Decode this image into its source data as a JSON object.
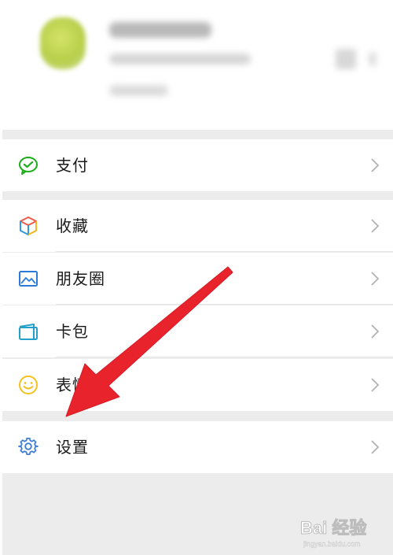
{
  "menu": {
    "items": [
      {
        "id": "pay",
        "label": "支付",
        "icon": "wechat-pay-icon"
      },
      {
        "id": "favorites",
        "label": "收藏",
        "icon": "cube-icon"
      },
      {
        "id": "moments",
        "label": "朋友圈",
        "icon": "image-icon"
      },
      {
        "id": "cards",
        "label": "卡包",
        "icon": "card-wallet-icon"
      },
      {
        "id": "stickers",
        "label": "表情",
        "icon": "smiley-icon"
      },
      {
        "id": "settings",
        "label": "设置",
        "icon": "gear-icon"
      }
    ]
  },
  "colors": {
    "pay_green": "#1aad19",
    "moments_blue": "#2b7bd8",
    "cards_teal": "#25a0c8",
    "sticker_yellow": "#f4c21f",
    "settings_blue": "#3d7fd6",
    "arrow_red": "#e8232c",
    "separator_gray": "#ececec"
  },
  "annotation": {
    "type": "arrow",
    "points_to": "settings"
  },
  "watermark": {
    "text": "Bai 经验",
    "subtext": "jingyan.baidu.com"
  }
}
